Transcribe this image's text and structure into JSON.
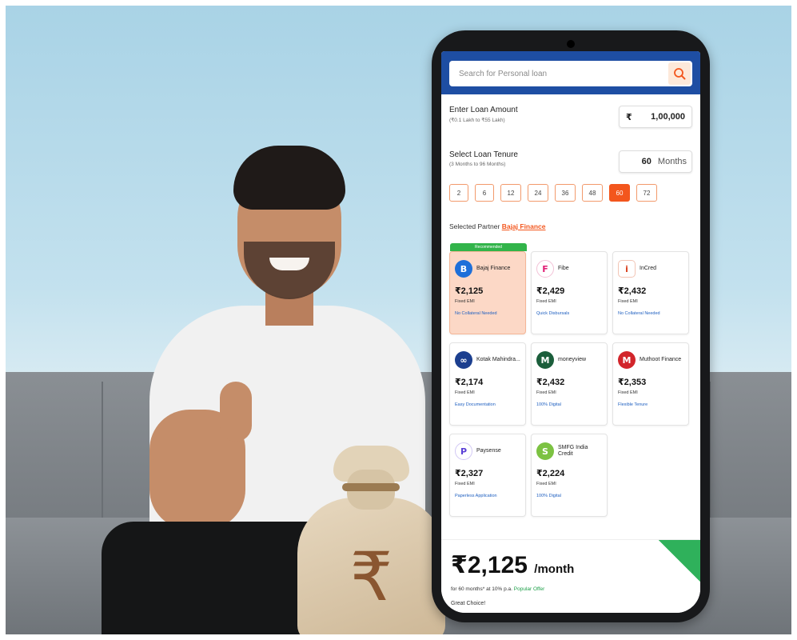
{
  "search": {
    "placeholder": "Search for Personal loan",
    "icon": "search-icon"
  },
  "loan_amount": {
    "label": "Enter Loan Amount",
    "hint": "(₹0.1 Lakh to ₹55 Lakh)",
    "currency": "₹",
    "value": "1,00,000"
  },
  "tenure": {
    "label": "Select Loan Tenure",
    "hint": "(3 Months to 96 Months)",
    "value": "60",
    "unit": "Months",
    "options": [
      "2",
      "6",
      "12",
      "24",
      "36",
      "48",
      "60",
      "72"
    ],
    "selected": "60"
  },
  "selected_partner": {
    "label": "Selected Partner",
    "name": "Bajaj Finance"
  },
  "recommended_label": "Recommended",
  "emi_label": "Fixed EMI",
  "partners": [
    {
      "name": "Bajaj Finance",
      "emi": "₹2,125",
      "tag": "No Collateral Needed",
      "logo_text": "B",
      "logo_color": "#1e6fd9"
    },
    {
      "name": "Fibe",
      "emi": "₹2,429",
      "tag": "Quick Disbursals",
      "logo_text": "F",
      "logo_color": "#e11d74"
    },
    {
      "name": "InCred",
      "emi": "₹2,432",
      "tag": "No Collateral Needed",
      "logo_text": "i",
      "logo_color": "#d9401e"
    },
    {
      "name": "Kotak Mahindra...",
      "emi": "₹2,174",
      "tag": "Easy Documentation",
      "logo_text": "∞",
      "logo_color": "#1c3f8f"
    },
    {
      "name": "moneyview",
      "emi": "₹2,432",
      "tag": "100% Digital",
      "logo_text": "M",
      "logo_color": "#1b5e3b"
    },
    {
      "name": "Muthoot Finance",
      "emi": "₹2,353",
      "tag": "Flexible Tenure",
      "logo_text": "M",
      "logo_color": "#d2252b"
    },
    {
      "name": "Paysense",
      "emi": "₹2,327",
      "tag": "Paperless Application",
      "logo_text": "P",
      "logo_color": "#5a3fd6"
    },
    {
      "name": "SMFG India Credit",
      "emi": "₹2,224",
      "tag": "100% Digital",
      "logo_text": "S",
      "logo_color": "#7cc242"
    }
  ],
  "summary": {
    "price": "₹2,125",
    "per": "/month",
    "fine_print": "for 60 months* at 10% p.a.",
    "offer": "Popular Offer",
    "choice": "Great Choice!"
  },
  "colors": {
    "header_blue": "#1e4ea3",
    "accent_orange": "#f3561d",
    "recommended_green": "#32b44a"
  }
}
